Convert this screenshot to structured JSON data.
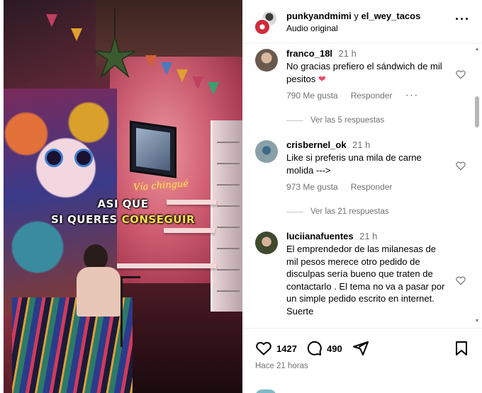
{
  "video": {
    "caption_line1": "ASI QUE",
    "caption_line2_prefix": "SI QUERES",
    "caption_line2_highlight": "CONSEGUIR",
    "neon_sign": "Vía chingué"
  },
  "post_header": {
    "user1": "punkyandmimi",
    "connector": "y",
    "user2": "el_wey_tacos",
    "audio": "Audio original",
    "more_icon": "more-horizontal-icon"
  },
  "comments": [
    {
      "username": "franco_18l",
      "time": "21 h",
      "text": "No gracias prefiero el sándwich de mil pesitos",
      "emoji": "❤",
      "likes": "790 Me gusta",
      "reply": "Responder",
      "view_replies": "Ver las 5 respuestas",
      "avatar_color": "#6a5a4e"
    },
    {
      "username": "crisbernel_ok",
      "time": "21 h",
      "text": "Like si preferis una mila de carne molida --->",
      "likes": "973 Me gusta",
      "reply": "Responder",
      "view_replies": "Ver las 21 respuestas",
      "avatar_color": "#8aa0a8"
    },
    {
      "username": "luciianafuentes",
      "time": "21 h",
      "text": "El emprendedor de las milanesas de mil pesos merece otro pedido de disculpas sería bueno que traten de contactarlo . El tema no va a pasar por un simple pedido escrito en internet. Suerte",
      "avatar_color": "#3f4a2e"
    }
  ],
  "actions": {
    "like_count": "1427",
    "comment_count": "490",
    "posted_time": "Hace 21 horas"
  },
  "colors": {
    "muted_text": "#737373",
    "divider": "#efefef",
    "heart": "#ed4a6b"
  }
}
